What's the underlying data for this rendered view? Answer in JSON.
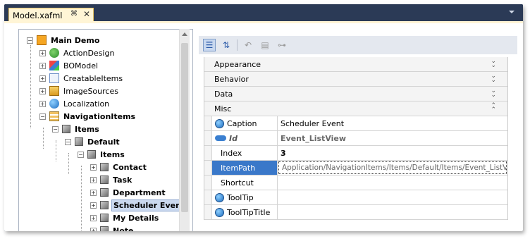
{
  "tab": {
    "title": "Model.xafml",
    "pin_glyph": "⌘",
    "close_glyph": "✕"
  },
  "tree": {
    "items": [
      {
        "label": "Main Demo",
        "bold": true,
        "expander": "-",
        "icon": "app-icon"
      },
      {
        "label": "ActionDesign",
        "bold": false,
        "expander": "+",
        "icon": "actions-icon"
      },
      {
        "label": "BOModel",
        "bold": false,
        "expander": "+",
        "icon": "bomodel-icon"
      },
      {
        "label": "CreatableItems",
        "bold": false,
        "expander": "+",
        "icon": "creatable-icon"
      },
      {
        "label": "ImageSources",
        "bold": false,
        "expander": "+",
        "icon": "images-icon"
      },
      {
        "label": "Localization",
        "bold": false,
        "expander": "+",
        "icon": "globe-icon"
      },
      {
        "label": "NavigationItems",
        "bold": true,
        "expander": "-",
        "icon": "navigation-icon"
      },
      {
        "label": "Items",
        "bold": true,
        "expander": "-",
        "icon": "cube-icon"
      },
      {
        "label": "Default",
        "bold": true,
        "expander": "-",
        "icon": "cube-icon"
      },
      {
        "label": "Items",
        "bold": true,
        "expander": "-",
        "icon": "cube-icon"
      },
      {
        "label": "Contact",
        "bold": true,
        "expander": "+",
        "icon": "cube-icon"
      },
      {
        "label": "Task",
        "bold": true,
        "expander": "+",
        "icon": "cube-icon"
      },
      {
        "label": "Department",
        "bold": true,
        "expander": "+",
        "icon": "cube-icon"
      },
      {
        "label": "Scheduler Event",
        "bold": true,
        "expander": "+",
        "icon": "cube-icon",
        "selected": true
      },
      {
        "label": "My Details",
        "bold": true,
        "expander": "+",
        "icon": "cube-icon"
      },
      {
        "label": "Note",
        "bold": true,
        "expander": "+",
        "icon": "cube-icon"
      }
    ]
  },
  "toolbar": {
    "categorized_icon": "categorized-icon",
    "sort_icon": "sort-az-icon",
    "undo_icon": "undo-icon",
    "reset_icon": "reset-icon",
    "link_icon": "link-icon"
  },
  "grid": {
    "categories": [
      {
        "label": "Appearance",
        "state": "collapsed"
      },
      {
        "label": "Behavior",
        "state": "collapsed"
      },
      {
        "label": "Data",
        "state": "collapsed"
      },
      {
        "label": "Misc",
        "state": "expanded"
      }
    ],
    "rows": [
      {
        "name": "Caption",
        "value": "Scheduler Event",
        "icon": "globe-icon"
      },
      {
        "name": "Id",
        "value": "Event_ListView",
        "icon": "key-icon",
        "readonly": true
      },
      {
        "name": "Index",
        "value": "3"
      },
      {
        "name": "ItemPath",
        "value": "Application/NavigationItems/Items/Default/Items/Event_ListView",
        "highlighted": true
      },
      {
        "name": "Shortcut",
        "value": ""
      },
      {
        "name": "ToolTip",
        "value": "",
        "icon": "globe-icon"
      },
      {
        "name": "ToolTipTitle",
        "value": "",
        "icon": "globe-icon"
      }
    ]
  },
  "colors": {
    "frame": "#2b3a56",
    "tab_active": "#fff5d6",
    "selection": "#3a78c9"
  }
}
